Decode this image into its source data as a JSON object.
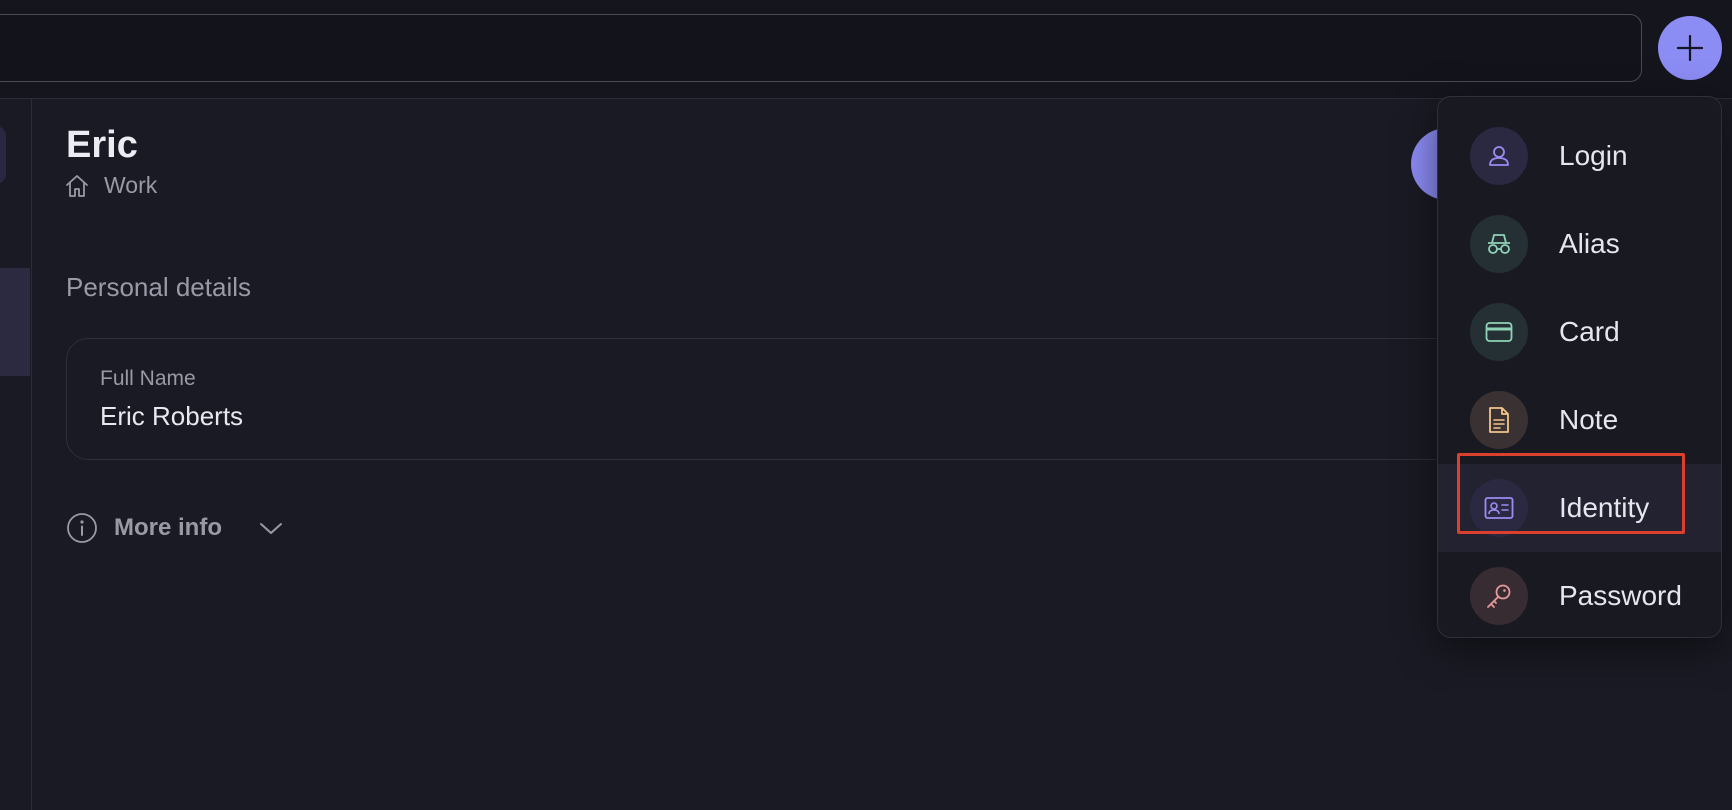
{
  "header": {
    "add_button_icon": "plus-icon"
  },
  "item": {
    "title": "Eric",
    "vault_icon": "home-icon",
    "vault_name": "Work"
  },
  "personal_details": {
    "section_title": "Personal details",
    "fields": [
      {
        "label": "Full Name",
        "value": "Eric Roberts"
      }
    ]
  },
  "more_info": {
    "label": "More info",
    "icon": "info-icon",
    "toggle_icon": "chevron-down-icon"
  },
  "create_menu": {
    "items": [
      {
        "label": "Login",
        "icon": "user-icon",
        "icon_color": "#9b8cf2",
        "bg": "#2b2942",
        "selected": false
      },
      {
        "label": "Alias",
        "icon": "incognito-icon",
        "icon_color": "#8fd3b6",
        "bg": "#253034",
        "selected": false
      },
      {
        "label": "Card",
        "icon": "credit-card-icon",
        "icon_color": "#8fd3b6",
        "bg": "#253034",
        "selected": false
      },
      {
        "label": "Note",
        "icon": "document-icon",
        "icon_color": "#f2c58a",
        "bg": "#3a3232",
        "selected": false
      },
      {
        "label": "Identity",
        "icon": "id-card-icon",
        "icon_color": "#9b8cf2",
        "bg": "#2b2942",
        "selected": true
      },
      {
        "label": "Password",
        "icon": "key-icon",
        "icon_color": "#e79a9a",
        "bg": "#382c33",
        "selected": false
      }
    ]
  },
  "colors": {
    "accent": "#8c8cf5",
    "background": "#1a1a24",
    "highlight_box": "#d9402e"
  }
}
